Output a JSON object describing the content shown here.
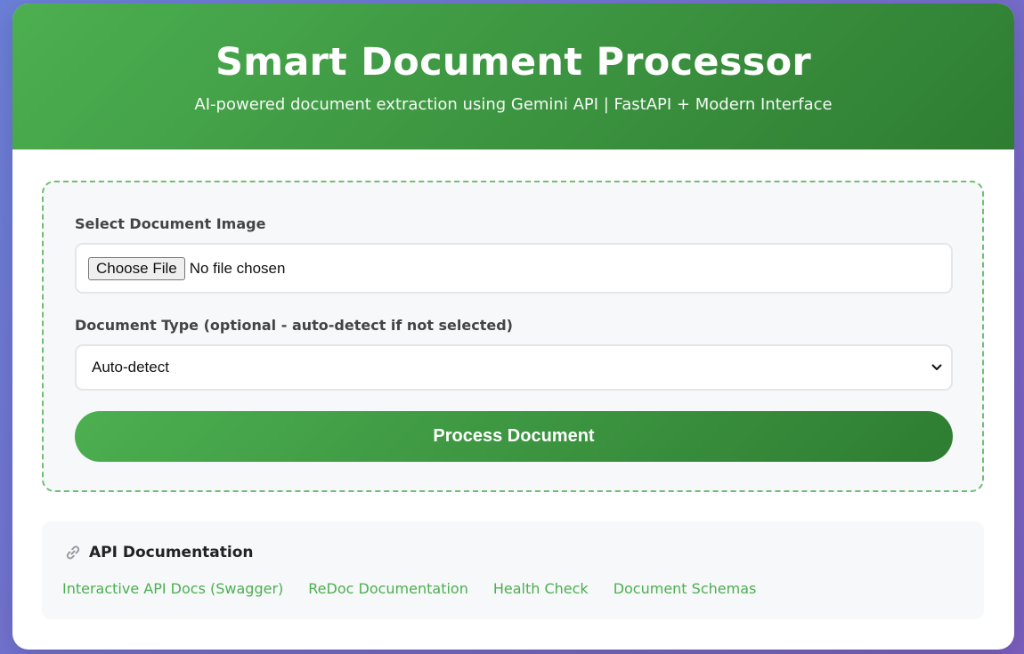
{
  "header": {
    "title": "Smart Document Processor",
    "subtitle": "AI-powered document extraction using Gemini API | FastAPI + Modern Interface"
  },
  "form": {
    "file_label": "Select Document Image",
    "choose_file_label": "Choose File",
    "file_status": "No file chosen",
    "type_label": "Document Type (optional - auto-detect if not selected)",
    "type_selected": "Auto-detect",
    "submit_label": "Process Document"
  },
  "api": {
    "icon": "link-icon",
    "title": "API Documentation",
    "links": [
      {
        "label": "Interactive API Docs (Swagger)"
      },
      {
        "label": "ReDoc Documentation"
      },
      {
        "label": "Health Check"
      },
      {
        "label": "Document Schemas"
      }
    ]
  },
  "colors": {
    "accent": "#4caf50",
    "accent_dark": "#2e7d32",
    "background_gradient_start": "#6b7fd8",
    "background_gradient_end": "#7b5fc0"
  }
}
